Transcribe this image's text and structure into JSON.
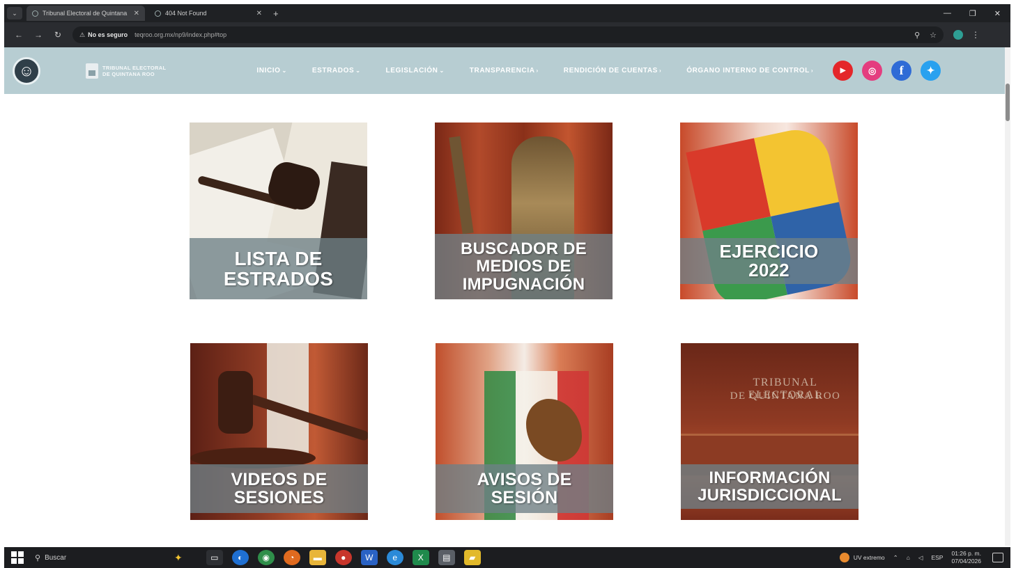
{
  "browser": {
    "tabs": [
      {
        "title": "Tribunal Electoral de Quintana",
        "active": true
      },
      {
        "title": "404 Not Found",
        "active": false
      }
    ],
    "security_label": "No es seguro",
    "url": "teqroo.org.mx/np9/index.php#top"
  },
  "header": {
    "logo_line1": "TRIBUNAL ELECTORAL",
    "logo_line2": "DE QUINTANA ROO",
    "nav": [
      {
        "label": "INICIO",
        "arrow": "⌄"
      },
      {
        "label": "ESTRADOS",
        "arrow": "⌄"
      },
      {
        "label": "LEGISLACIÓN",
        "arrow": "⌄"
      },
      {
        "label": "TRANSPARENCIA",
        "arrow": "›"
      },
      {
        "label": "RENDICIÓN DE CUENTAS",
        "arrow": "›"
      },
      {
        "label": "ÓRGANO INTERNO DE CONTROL",
        "arrow": "›"
      }
    ],
    "social_icons": [
      "youtube-icon",
      "instagram-icon",
      "facebook-icon",
      "twitter-icon"
    ]
  },
  "tiles": [
    {
      "label": "LISTA DE ESTRADOS"
    },
    {
      "label": "BUSCADOR DE MEDIOS DE IMPUGNACIÓN"
    },
    {
      "label": "EJERCICIO 2022"
    },
    {
      "label": "VIDEOS DE SESIONES"
    },
    {
      "label": "AVISOS DE SESIÓN"
    },
    {
      "label": "INFORMACIÓN JURISDICCIONAL"
    }
  ],
  "tile_photo_text": {
    "line1": "TRIBUNAL ELECTORAL",
    "line2": "DE QUINTANA ROO"
  },
  "taskbar": {
    "search_placeholder": "Buscar",
    "weather": "UV extremo",
    "language": "ESP",
    "time": "01:26 p. m.",
    "date": "07/04/2026"
  },
  "colors": {
    "header_bg": "#b7cdd2",
    "tile_band": "#6e8086"
  }
}
